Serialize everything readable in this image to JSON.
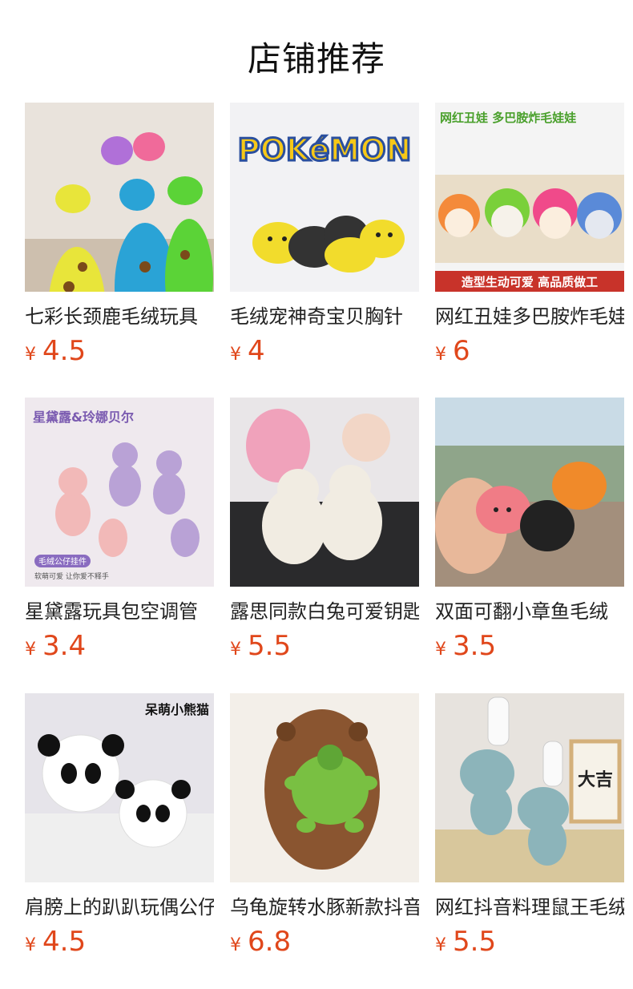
{
  "section": {
    "title": "店铺推荐"
  },
  "currency": "¥",
  "products": [
    {
      "name": "七彩长颈鹿毛绒玩具",
      "price": "4.5"
    },
    {
      "name": "毛绒宠神奇宝贝胸针",
      "price": "4",
      "image_text": "POKéMON"
    },
    {
      "name": "网红丑娃多巴胺炸毛娃",
      "price": "6",
      "image_text_top": "网红丑娃 多巴胺炸毛娃娃",
      "image_text_bottom": "造型生动可爱 高品质做工"
    },
    {
      "name": "星黛露玩具包空调管",
      "price": "3.4",
      "image_text_top": "星黛露&玲娜贝尔",
      "image_badge": "毛绒公仔挂件",
      "image_caption": "软萌可爱 让你爱不释手"
    },
    {
      "name": "露思同款白兔可爱钥匙",
      "price": "5.5"
    },
    {
      "name": "双面可翻小章鱼毛绒",
      "price": "3.5"
    },
    {
      "name": "肩膀上的趴趴玩偶公仔",
      "price": "4.5",
      "image_text_top": "呆萌小熊猫"
    },
    {
      "name": "乌龟旋转水豚新款抖音",
      "price": "6.8"
    },
    {
      "name": "网红抖音料理鼠王毛绒",
      "price": "5.5",
      "image_text_top": "大吉"
    }
  ],
  "colors": {
    "price": "#e0471b",
    "title": "#111111"
  }
}
